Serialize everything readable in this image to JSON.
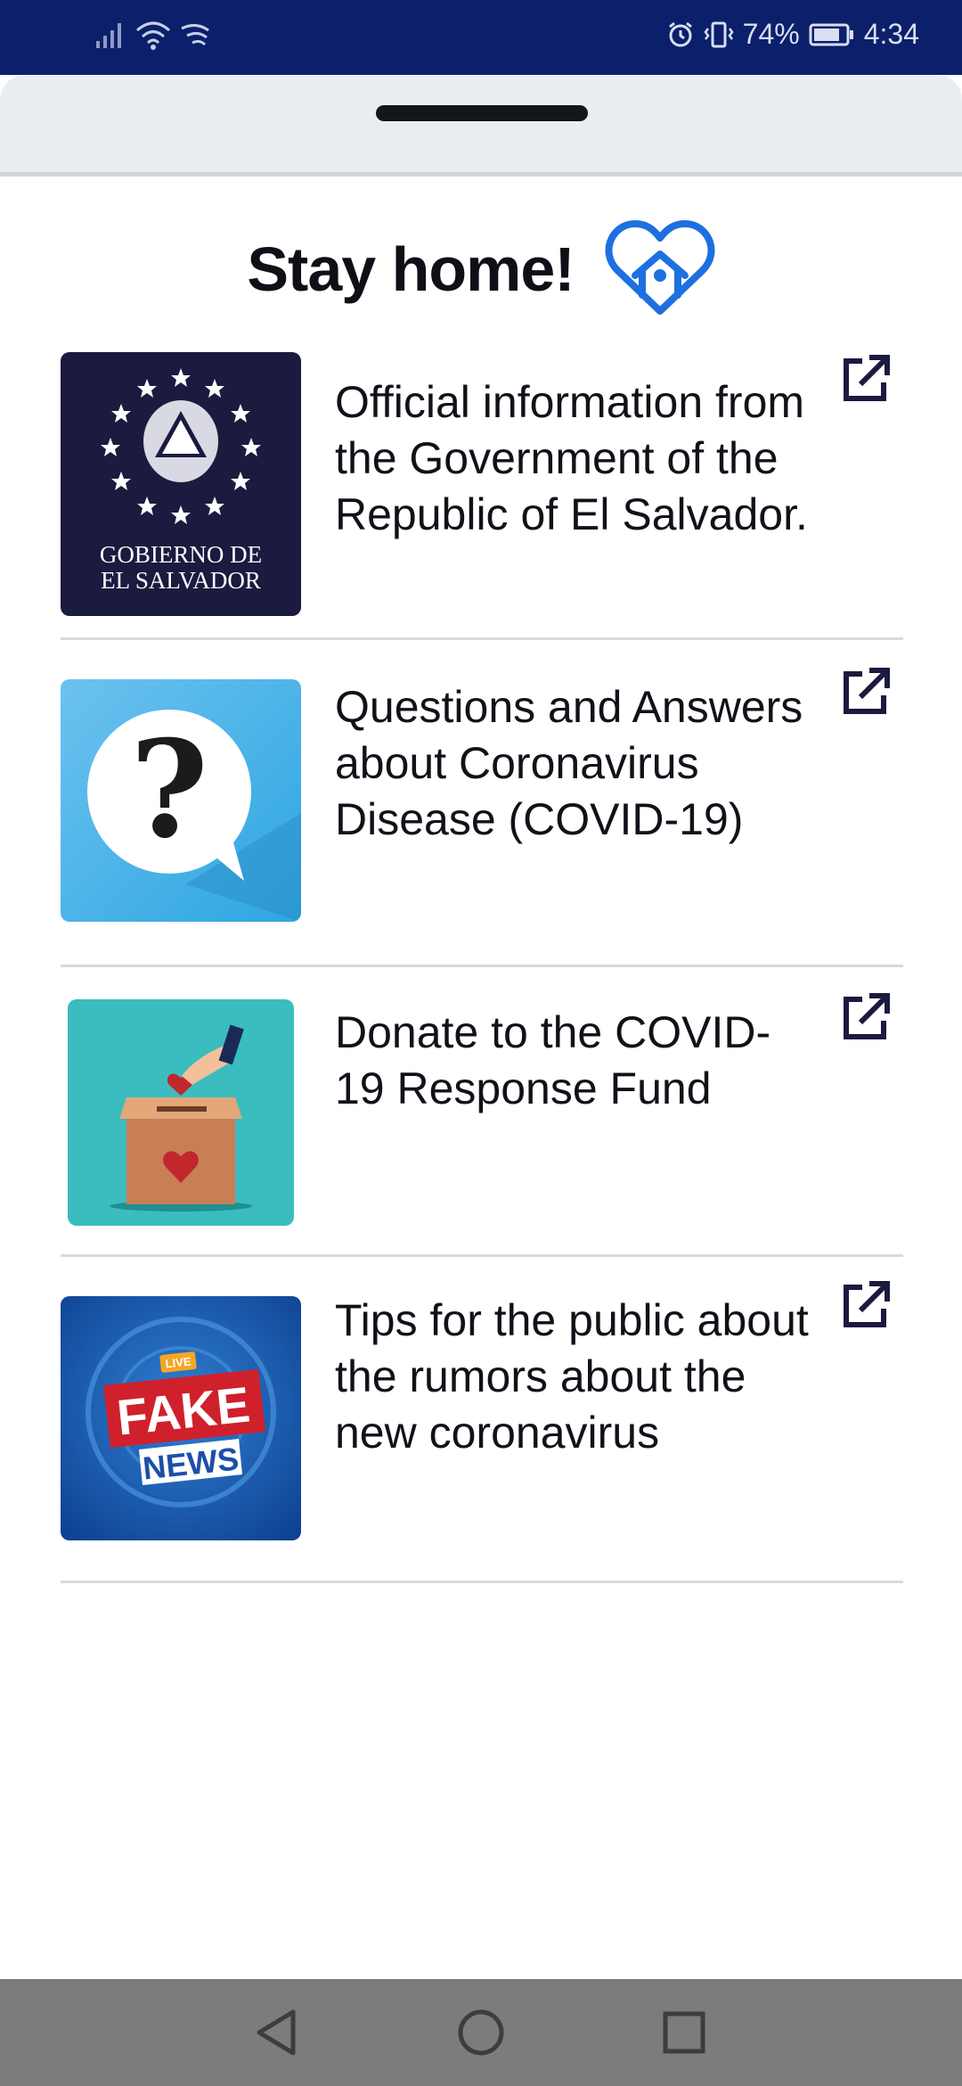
{
  "status_bar": {
    "battery": "74%",
    "time": "4:34",
    "icons": [
      "signal-icon",
      "wifi-icon",
      "data-icon",
      "alarm-icon",
      "vibrate-icon",
      "battery-icon"
    ]
  },
  "header": {
    "title": "Stay home!",
    "title_icon": "heart-home-icon",
    "accent_color": "#1e6fe0"
  },
  "items": [
    {
      "text": "Official information from the Government of the Republic of El Salvador.",
      "thumb_icon": "government-seal-icon",
      "thumb_caption_line1": "GOBIERNO DE",
      "thumb_caption_line2": "EL SALVADOR",
      "action_icon": "external-link-icon"
    },
    {
      "text": "Questions and Answers about Coronavirus Disease (COVID-19)",
      "thumb_icon": "question-bubble-icon",
      "action_icon": "external-link-icon"
    },
    {
      "text": "Donate to the COVID-19 Response Fund",
      "thumb_icon": "donation-box-icon",
      "action_icon": "external-link-icon"
    },
    {
      "text": "Tips for the public about the rumors about the new coronavirus",
      "thumb_icon": "fake-news-icon",
      "thumb_badge": "LIVE",
      "thumb_word1": "FAKE",
      "thumb_word2": "NEWS",
      "action_icon": "external-link-icon"
    }
  ],
  "nav_bar": {
    "buttons": [
      "back-icon",
      "home-icon",
      "recents-icon"
    ]
  }
}
